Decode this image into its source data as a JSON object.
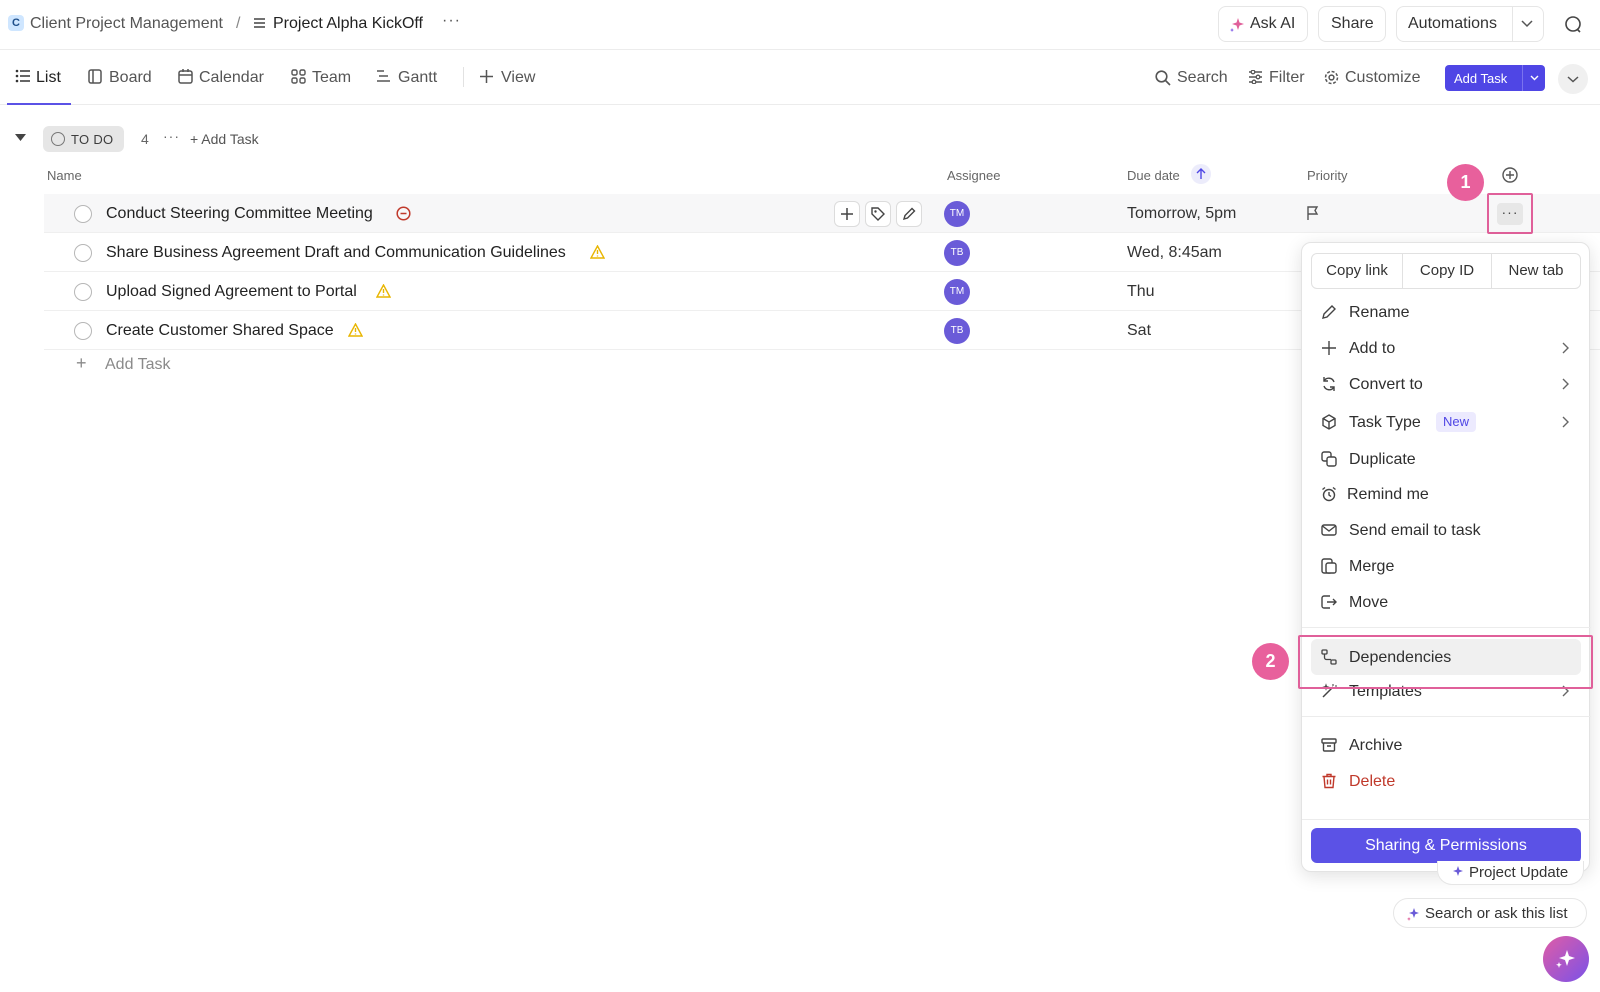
{
  "breadcrumb": {
    "workspace_initial": "C",
    "workspace": "Client Project Management",
    "separator": "/",
    "list": "Project Alpha KickOff",
    "more": "···"
  },
  "topbar": {
    "ask_ai": "Ask AI",
    "share": "Share",
    "automations": "Automations"
  },
  "views": {
    "tabs": [
      {
        "label": "List",
        "active": true
      },
      {
        "label": "Board"
      },
      {
        "label": "Calendar"
      },
      {
        "label": "Team"
      },
      {
        "label": "Gantt"
      }
    ],
    "add_view": "View",
    "search": "Search",
    "filter": "Filter",
    "customize": "Customize",
    "add_task": "Add Task"
  },
  "group": {
    "status": "TO DO",
    "count": "4",
    "more": "···",
    "add_task": "+ Add Task"
  },
  "columns": {
    "name": "Name",
    "assignee": "Assignee",
    "due_date": "Due date",
    "priority": "Priority"
  },
  "tasks": [
    {
      "name": "Conduct Steering Committee Meeting",
      "flag_icon": "blocked-icon",
      "assignee": "TM",
      "due": "Tomorrow, 5pm"
    },
    {
      "name": "Share Business Agreement Draft and Communication Guidelines",
      "flag_icon": "warning-icon",
      "assignee": "TB",
      "due": "Wed, 8:45am"
    },
    {
      "name": "Upload Signed Agreement to Portal",
      "flag_icon": "warning-icon",
      "assignee": "TM",
      "due": "Thu"
    },
    {
      "name": "Create Customer Shared Space",
      "flag_icon": "warning-icon",
      "assignee": "TB",
      "due": "Sat"
    }
  ],
  "add_task_row": "Add Task",
  "row_more": "···",
  "steps": {
    "one": "1",
    "two": "2"
  },
  "menu": {
    "copy_link": "Copy link",
    "copy_id": "Copy ID",
    "new_tab": "New tab",
    "rename": "Rename",
    "add_to": "Add to",
    "convert_to": "Convert to",
    "task_type": "Task Type",
    "new_badge": "New",
    "duplicate": "Duplicate",
    "remind_me": "Remind me",
    "send_email": "Send email to task",
    "merge": "Merge",
    "move": "Move",
    "dependencies": "Dependencies",
    "templates": "Templates",
    "archive": "Archive",
    "delete": "Delete",
    "sharing": "Sharing & Permissions"
  },
  "chips": {
    "project_update": "Project Update",
    "search_ask": "Search or ask this list"
  },
  "colors": {
    "accent": "#5b52e6",
    "highlight": "#e0609a",
    "danger": "#c0392b",
    "warning": "#e8b500",
    "avatar": "#6a5bd8"
  }
}
